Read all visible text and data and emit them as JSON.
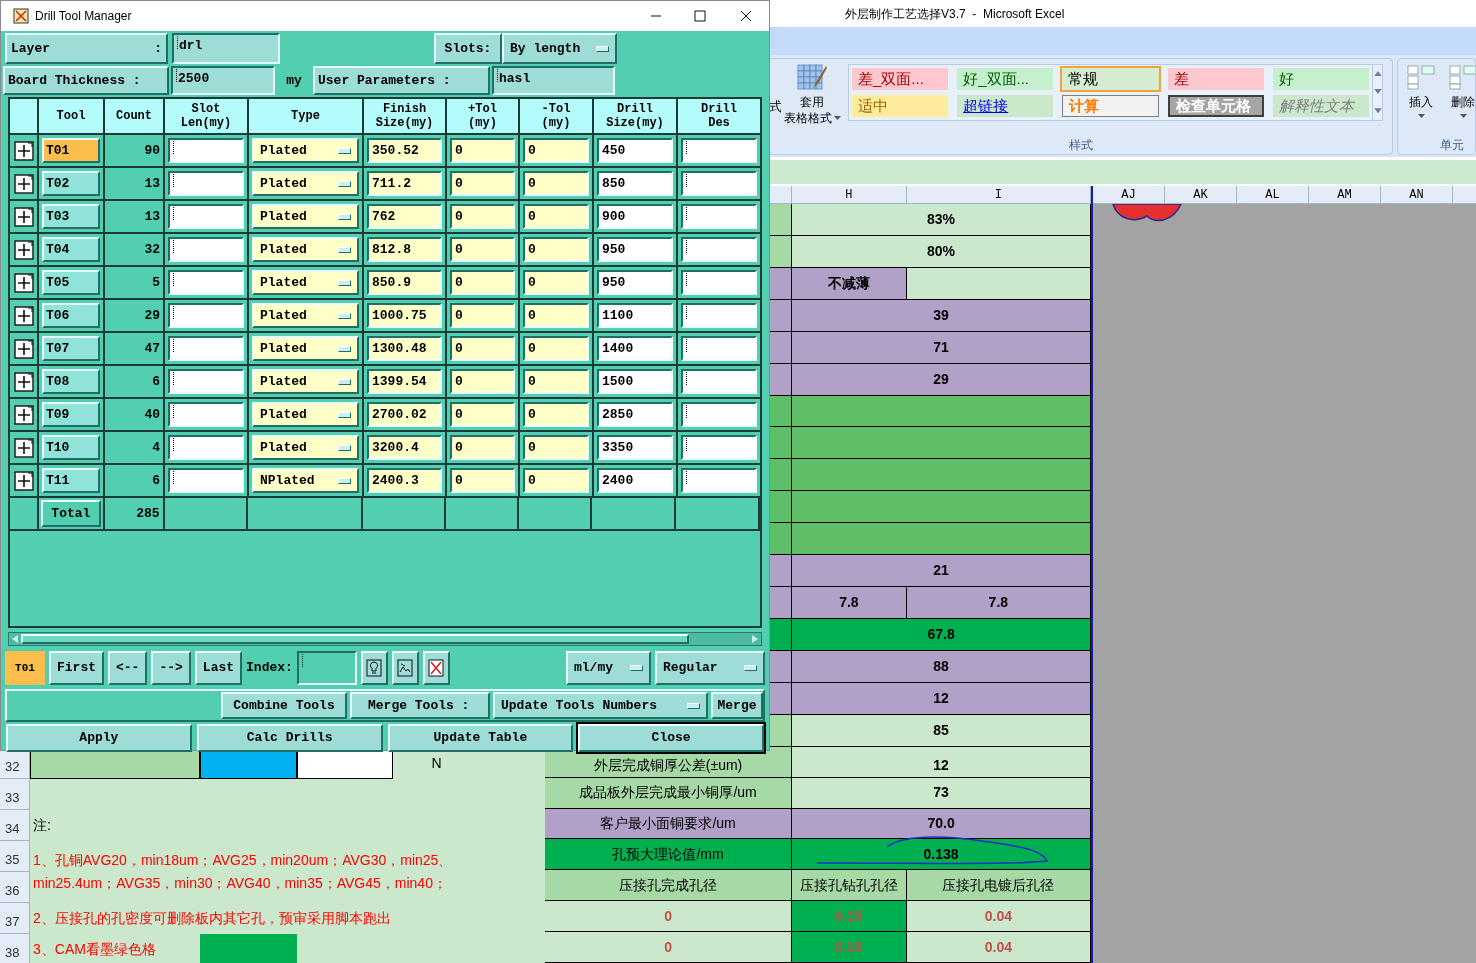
{
  "excel": {
    "title": "外层制作工艺选择V3.7  -  Microsoft Excel",
    "ribbon": {
      "cut_label": "式",
      "table_format": [
        "套用",
        "表格格式"
      ],
      "styles": [
        {
          "label": "差_双面...",
          "kind": "bad",
          "selected": false
        },
        {
          "label": "好_双面...",
          "kind": "good",
          "selected": false
        },
        {
          "label": "常规",
          "kind": "normal",
          "selected": true
        },
        {
          "label": "差",
          "kind": "bad",
          "selected": false
        },
        {
          "label": "好",
          "kind": "good",
          "selected": false
        },
        {
          "label": "适中",
          "kind": "neutral",
          "selected": false
        },
        {
          "label": "超链接",
          "kind": "link",
          "selected": false
        },
        {
          "label": "计算",
          "kind": "calc",
          "selected": false
        },
        {
          "label": "检查单元格",
          "kind": "check",
          "selected": false
        },
        {
          "label": "解释性文本",
          "kind": "note",
          "selected": false
        }
      ],
      "styles_group": "样式",
      "insert": "插入",
      "delete": "删除",
      "cells_group": "单元"
    },
    "column_headers": [
      "H",
      "I"
    ],
    "far_columns": [
      "AJ",
      "AK",
      "AL",
      "AM",
      "AN"
    ],
    "upper_rows": [
      {
        "cells": [
          {
            "color": "#a6d9a6"
          },
          {
            "text": "83%",
            "color": "#cce8cc",
            "kind": "value"
          }
        ]
      },
      {
        "cells": [
          {
            "color": "#a6d9a6"
          },
          {
            "text": "80%",
            "color": "#cce8cc",
            "kind": "value"
          }
        ]
      },
      {
        "cells": [
          {
            "color": "#b1a0c7"
          },
          {
            "text": "不减薄",
            "color": "#b1a0c7",
            "kind": "value"
          },
          {
            "color": "#cce8cc"
          }
        ]
      },
      {
        "cells": [
          {
            "color": "#b1a0c7"
          },
          {
            "text": "39",
            "color": "#b1a0c7",
            "kind": "value"
          }
        ]
      },
      {
        "cells": [
          {
            "color": "#b1a0c7"
          },
          {
            "text": "71",
            "color": "#b1a0c7",
            "kind": "value"
          }
        ]
      },
      {
        "cells": [
          {
            "color": "#b1a0c7"
          },
          {
            "text": "29",
            "color": "#b1a0c7",
            "kind": "value"
          }
        ]
      },
      {
        "cells": [
          {
            "color": "#5fbf69"
          },
          {
            "color": "#5fbf69"
          }
        ]
      },
      {
        "cells": [
          {
            "color": "#5fbf69"
          },
          {
            "color": "#5fbf69"
          }
        ]
      },
      {
        "cells": [
          {
            "color": "#5fbf69"
          },
          {
            "color": "#5fbf69"
          }
        ]
      },
      {
        "cells": [
          {
            "color": "#5fbf69"
          },
          {
            "color": "#5fbf69"
          }
        ]
      },
      {
        "cells": [
          {
            "color": "#5fbf69"
          },
          {
            "color": "#5fbf69"
          }
        ]
      },
      {
        "cells": [
          {
            "color": "#b1a0c7"
          },
          {
            "text": "21",
            "color": "#b1a0c7",
            "kind": "value"
          }
        ]
      },
      {
        "cells": [
          {
            "color": "#b1a0c7"
          },
          {
            "text": "7.8",
            "color": "#b1a0c7",
            "kind": "value"
          },
          {
            "text": "7.8",
            "color": "#b1a0c7",
            "kind": "value"
          }
        ]
      },
      {
        "cells": [
          {
            "color": "#00b050"
          },
          {
            "text": "67.8",
            "color": "#00b050",
            "kind": "value"
          }
        ]
      },
      {
        "cells": [
          {
            "color": "#b1a0c7"
          },
          {
            "text": "88",
            "color": "#b1a0c7",
            "kind": "value"
          }
        ]
      },
      {
        "cells": [
          {
            "color": "#b1a0c7"
          },
          {
            "text": "12",
            "color": "#b1a0c7",
            "kind": "value"
          }
        ]
      },
      {
        "cells": [
          {
            "color": "#a6d9a6"
          },
          {
            "text": "85",
            "color": "#cce8cc",
            "kind": "value"
          }
        ]
      }
    ],
    "lower_rows": [
      {
        "number": "32",
        "cells": [
          {
            "text": "外层完成铜厚公差(±um)",
            "color": "#a6d9a6",
            "kind": "label"
          },
          {
            "text": "12",
            "color": "#cce8cc",
            "kind": "value"
          }
        ]
      },
      {
        "number": "33",
        "cells": [
          {
            "text": "成品板外层完成最小铜厚/um",
            "color": "#a6d9a6",
            "kind": "label"
          },
          {
            "text": "73",
            "color": "#cce8cc",
            "kind": "value"
          }
        ]
      },
      {
        "number": "34",
        "cells": [
          {
            "text": "客户最小面铜要求/um",
            "color": "#b1a0c7",
            "kind": "label"
          },
          {
            "text": "70.0",
            "color": "#b1a0c7",
            "kind": "value"
          }
        ]
      },
      {
        "number": "35",
        "cells": [
          {
            "text": "孔预大理论值/mm",
            "color": "#00b050",
            "kind": "label"
          },
          {
            "text": "0.138",
            "color": "#00b050",
            "kind": "value",
            "scribbled": true
          }
        ]
      },
      {
        "number": "36",
        "cells": [
          {
            "text": "压接孔完成孔径",
            "color": "#a6d9a6",
            "kind": "label"
          },
          {
            "text": "压接孔钻孔孔径",
            "color": "#a6d9a6",
            "kind": "label"
          },
          {
            "text": "压接孔电镀后孔径",
            "color": "#a6d9a6",
            "kind": "label"
          }
        ]
      },
      {
        "number": "37",
        "cells": [
          {
            "text": "0",
            "color": "#cce8cc",
            "kind": "alert"
          },
          {
            "text": "0.15",
            "color": "#00b050",
            "kind": "alert"
          },
          {
            "text": "0.04",
            "color": "#cce8cc",
            "kind": "alert"
          }
        ]
      },
      {
        "number": "38",
        "cells": [
          {
            "text": "0",
            "color": "#cce8cc",
            "kind": "alert"
          },
          {
            "text": "0.15",
            "color": "#00b050",
            "kind": "alert"
          },
          {
            "text": "0.04",
            "color": "#cce8cc",
            "kind": "alert"
          }
        ]
      }
    ],
    "row32_left": [
      {
        "color": "#a6d9a6"
      },
      {
        "color": "#00b0f0"
      },
      {
        "color": "#ffffff"
      },
      {
        "text": "N",
        "color": "#cce8cc"
      }
    ],
    "notes": [
      {
        "text": "注:",
        "kind": "heading"
      },
      {
        "text": "1、孔铜AVG20，min18um；AVG25，min20um；AVG30，min25、min25.4um；AVG35，min30；AVG40，min35；AVG45，min40；",
        "kind": "long"
      },
      {
        "text": "2、压接孔的孔密度可删除板内其它孔，预审采用脚本跑出",
        "kind": "line"
      },
      {
        "text": "3、CAM看墨绿色格",
        "kind": "marked",
        "color": "#00b050"
      }
    ]
  },
  "dialog": {
    "title": "Drill Tool Manager",
    "layer": {
      "label": "Layer",
      "colon": ":",
      "value": "drl"
    },
    "slots": {
      "label": "Slots:",
      "value": "By length"
    },
    "thickness": {
      "label": "Board Thickness :",
      "value": "2500",
      "unit": "my"
    },
    "user_params": {
      "label": "User Parameters :",
      "value": "hasl"
    },
    "columns": [
      [
        "Tool"
      ],
      [
        "Count"
      ],
      [
        "Slot",
        "Len(my)"
      ],
      [
        "Type"
      ],
      [
        "Finish",
        "Size(my)"
      ],
      [
        "+Tol",
        "(my)"
      ],
      [
        "-Tol",
        "(my)"
      ],
      [
        "Drill",
        "Size(my)"
      ],
      [
        "Drill",
        "Des"
      ]
    ],
    "tools": [
      {
        "tool": "T01",
        "selected": true,
        "count": "90",
        "type": "Plated",
        "finish": "350.52",
        "plus_tol": "0",
        "minus_tol": "0",
        "drill_size": "450"
      },
      {
        "tool": "T02",
        "selected": false,
        "count": "13",
        "type": "Plated",
        "finish": "711.2",
        "plus_tol": "0",
        "minus_tol": "0",
        "drill_size": "850"
      },
      {
        "tool": "T03",
        "selected": false,
        "count": "13",
        "type": "Plated",
        "finish": "762",
        "plus_tol": "0",
        "minus_tol": "0",
        "drill_size": "900"
      },
      {
        "tool": "T04",
        "selected": false,
        "count": "32",
        "type": "Plated",
        "finish": "812.8",
        "plus_tol": "0",
        "minus_tol": "0",
        "drill_size": "950"
      },
      {
        "tool": "T05",
        "selected": false,
        "count": "5",
        "type": "Plated",
        "finish": "850.9",
        "plus_tol": "0",
        "minus_tol": "0",
        "drill_size": "950"
      },
      {
        "tool": "T06",
        "selected": false,
        "count": "29",
        "type": "Plated",
        "finish": "1000.75",
        "plus_tol": "0",
        "minus_tol": "0",
        "drill_size": "1100"
      },
      {
        "tool": "T07",
        "selected": false,
        "count": "47",
        "type": "Plated",
        "finish": "1300.48",
        "plus_tol": "0",
        "minus_tol": "0",
        "drill_size": "1400"
      },
      {
        "tool": "T08",
        "selected": false,
        "count": "6",
        "type": "Plated",
        "finish": "1399.54",
        "plus_tol": "0",
        "minus_tol": "0",
        "drill_size": "1500"
      },
      {
        "tool": "T09",
        "selected": false,
        "count": "40",
        "type": "Plated",
        "finish": "2700.02",
        "plus_tol": "0",
        "minus_tol": "0",
        "drill_size": "2850"
      },
      {
        "tool": "T10",
        "selected": false,
        "count": "4",
        "type": "Plated",
        "finish": "3200.4",
        "plus_tol": "0",
        "minus_tol": "0",
        "drill_size": "3350"
      },
      {
        "tool": "T11",
        "selected": false,
        "count": "6",
        "type": "NPlated",
        "finish": "2400.3",
        "plus_tol": "0",
        "minus_tol": "0",
        "drill_size": "2400"
      }
    ],
    "total": {
      "label": "Total",
      "count": "285"
    },
    "current_tool": "T01",
    "nav": [
      "First",
      "<--",
      "-->",
      "Last"
    ],
    "index_label": "Index:",
    "units": "ml/my",
    "mode": "Regular",
    "combine": "Combine Tools",
    "merge_label": "Merge Tools :",
    "merge_mode": "Update Tools Numbers",
    "merge": "Merge",
    "actions": [
      {
        "label": "Apply",
        "focused": false
      },
      {
        "label": "Calc Drills",
        "focused": false
      },
      {
        "label": "Update Table",
        "focused": false
      },
      {
        "label": "Close",
        "focused": true
      }
    ]
  }
}
